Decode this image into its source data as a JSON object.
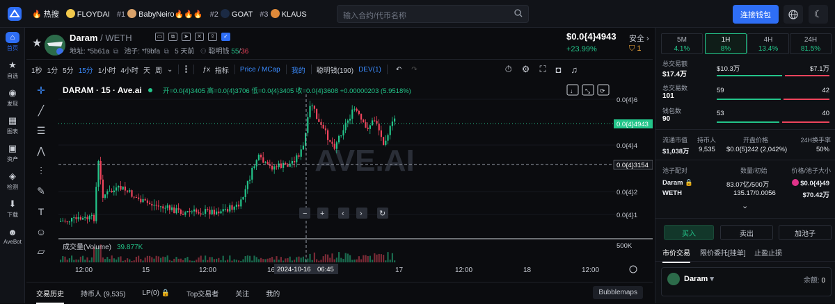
{
  "hot": {
    "label": "热搜",
    "items": [
      {
        "rank": "",
        "name": "FLOYDAI"
      },
      {
        "rank": "#1",
        "name": "BabyNeiro",
        "fire": "🔥🔥🔥"
      },
      {
        "rank": "#2",
        "name": "GOAT"
      },
      {
        "rank": "#3",
        "name": "KLAUS"
      }
    ]
  },
  "search": {
    "placeholder": "输入合约/代币名称"
  },
  "connect_label": "连接钱包",
  "nav": [
    {
      "label": "首页",
      "icon": "home-icon"
    },
    {
      "label": "自选",
      "icon": "star-icon"
    },
    {
      "label": "发现",
      "icon": "compass-icon"
    },
    {
      "label": "图表",
      "icon": "chart-icon"
    },
    {
      "label": "资产",
      "icon": "wallet-icon"
    },
    {
      "label": "检测",
      "icon": "shield-icon"
    },
    {
      "label": "下载",
      "icon": "download-icon"
    },
    {
      "label": "AveBot",
      "icon": "bot-icon"
    }
  ],
  "token": {
    "name": "Daram",
    "quote": "WETH",
    "addr_label": "地址: *5b61a",
    "pool_label": "池子: *f9bfa",
    "age": "5 天前",
    "smart_label": "聪明钱",
    "smart_a": "55",
    "smart_sep": "/",
    "smart_b": "36",
    "price": "$0.0{4}4943",
    "change": "+23.99%",
    "safe_label": "安全",
    "safe_num": "1"
  },
  "toolbar": {
    "intervals": [
      "1秒",
      "1分",
      "5分",
      "15分",
      "1小时",
      "4小时",
      "天",
      "周"
    ],
    "active": "15分",
    "indicator": "指标",
    "price_mcap": "Price / MCap",
    "mine": "我的",
    "smart": "聪明钱(190)",
    "dev": "DEV(1)"
  },
  "chart": {
    "title": "DARAM · 15 · Ave.ai",
    "ohlc": "开=0.0{4}3405  高=0.0{4}3706  低=0.0{4}3405  收=0.0{4}3608  +0.00000203 (5.9518%)",
    "y_ticks": [
      "0.0{4}6",
      "0.0{4}4",
      "0.0{4}2",
      "0.0{4}1"
    ],
    "current_price": "0.0{4}4943",
    "cross_price": "0.0{4}3154",
    "x_ticks": [
      "12:00",
      "15",
      "12:00",
      "16",
      "17",
      "12:00",
      "18",
      "12:00"
    ],
    "cross_date": "2024-10-16",
    "cross_time": "06:45",
    "volume_label": "成交量(Volume)",
    "volume_value": "39.877K",
    "volume_tick": "500K",
    "watermark": "AVE.AI"
  },
  "chart_data": {
    "type": "candlestick",
    "title": "DARAM · 15 · Ave.ai",
    "open": "0.0{4}3405",
    "high": "0.0{4}3706",
    "low": "0.0{4}3405",
    "close": "0.0{4}3608",
    "change": "+0.00000203 (5.9518%)",
    "last_price": "0.0{4}4943"
  },
  "bottom_tabs": [
    "交易历史",
    "持币人 (9,535)",
    "LP(0)",
    "Top交易者",
    "关注",
    "我的"
  ],
  "bubblemaps": "Bubblemaps",
  "timeframes": [
    {
      "label": "5M",
      "pct": "4.1%"
    },
    {
      "label": "1H",
      "pct": "8%"
    },
    {
      "label": "4H",
      "pct": "13.4%"
    },
    {
      "label": "24H",
      "pct": "81.5%"
    }
  ],
  "stats": {
    "vol_label": "总交易额",
    "vol": "$17.4万",
    "buy_vol": "$10.3万",
    "sell_vol": "$7.1万",
    "tx_label": "总交易数",
    "tx": "101",
    "buy_tx": "59",
    "sell_tx": "42",
    "wallet_label": "钱包数",
    "wallet": "90",
    "buy_w": "53",
    "sell_w": "40"
  },
  "market": {
    "mcap_label": "流通市值",
    "mcap": "$1,038万",
    "holders_label": "持币人",
    "holders": "9,535",
    "open_label": "开盘价格",
    "open": "$0.0{5}242 (2,042%)",
    "turnover_label": "24H换手率",
    "turnover": "50%"
  },
  "pool": {
    "pair_label": "池子配对",
    "amount_label": "数量/初始",
    "price_label": "价格/池子大小",
    "a_name": "Daram",
    "a_amt": "83.07亿/500万",
    "a_price": "$0.0{4}49",
    "b_name": "WETH",
    "b_amt": "135.17/0.0056",
    "b_price": "$70.42万"
  },
  "actions": {
    "buy": "买入",
    "sell": "卖出",
    "add": "加池子"
  },
  "trade_tabs": [
    "市价交易",
    "限价委托[挂单]",
    "止盈止损"
  ],
  "wallet": {
    "token": "Daram",
    "balance_label": "余额:",
    "balance": "0"
  }
}
